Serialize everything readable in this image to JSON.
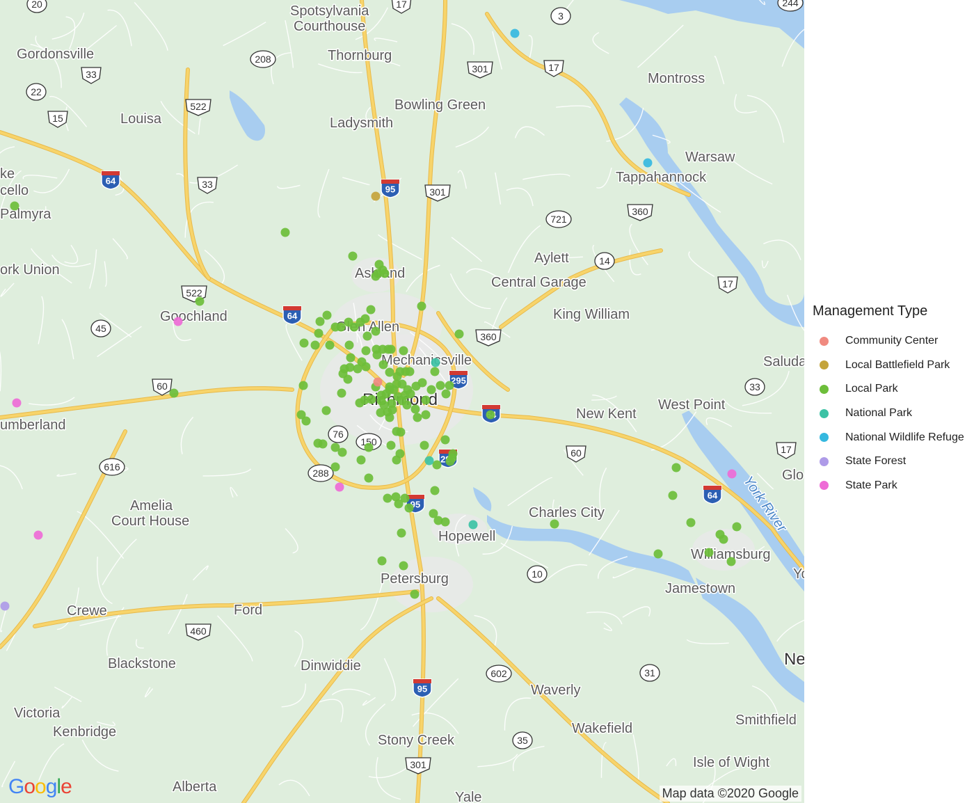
{
  "map": {
    "attribution": "Map data ©2020 Google",
    "logo": "Google",
    "logo_colors": [
      "#4285F4",
      "#EA4335",
      "#FBBC05",
      "#4285F4",
      "#34A853",
      "#EA4335"
    ],
    "colors": {
      "land": "#dfeedd",
      "water": "#a8cdf0",
      "highway": "#f7d46b",
      "urban": "#e9e9e9"
    },
    "places": [
      {
        "name": "Spotsylvania",
        "kind": "city"
      },
      {
        "name": "Courthouse",
        "kind": "city"
      },
      {
        "name": "Gordonsville",
        "kind": "city"
      },
      {
        "name": "Thornburg",
        "kind": "city"
      },
      {
        "name": "Montross",
        "kind": "city"
      },
      {
        "name": "Bowling Green",
        "kind": "city"
      },
      {
        "name": "Louisa",
        "kind": "city"
      },
      {
        "name": "Ladysmith",
        "kind": "city"
      },
      {
        "name": "Warsaw",
        "kind": "city"
      },
      {
        "name": "Tappahannock",
        "kind": "city"
      },
      {
        "name": "ke",
        "kind": "city"
      },
      {
        "name": "cello",
        "kind": "city"
      },
      {
        "name": "Palmyra",
        "kind": "city"
      },
      {
        "name": "Aylett",
        "kind": "city"
      },
      {
        "name": "Ashland",
        "kind": "city"
      },
      {
        "name": "Central Garage",
        "kind": "city"
      },
      {
        "name": "ork Union",
        "kind": "city"
      },
      {
        "name": "King William",
        "kind": "city"
      },
      {
        "name": "Goochland",
        "kind": "city"
      },
      {
        "name": "Glen Allen",
        "kind": "city"
      },
      {
        "name": "Mechanicsville",
        "kind": "city"
      },
      {
        "name": "Saluda",
        "kind": "city"
      },
      {
        "name": "Richmond",
        "kind": "major"
      },
      {
        "name": "West Point",
        "kind": "city"
      },
      {
        "name": "New Kent",
        "kind": "city"
      },
      {
        "name": "umberland",
        "kind": "city"
      },
      {
        "name": "Glo",
        "kind": "city"
      },
      {
        "name": "York River",
        "kind": "water"
      },
      {
        "name": "Amelia",
        "kind": "city"
      },
      {
        "name": "Court House",
        "kind": "city"
      },
      {
        "name": "Charles City",
        "kind": "city"
      },
      {
        "name": "Hopewell",
        "kind": "city"
      },
      {
        "name": "Williamsburg",
        "kind": "city"
      },
      {
        "name": "Yo",
        "kind": "city"
      },
      {
        "name": "Petersburg",
        "kind": "city"
      },
      {
        "name": "Jamestown",
        "kind": "city"
      },
      {
        "name": "Crewe",
        "kind": "city"
      },
      {
        "name": "Ford",
        "kind": "city"
      },
      {
        "name": "Ne",
        "kind": "major"
      },
      {
        "name": "Blackstone",
        "kind": "city"
      },
      {
        "name": "Dinwiddie",
        "kind": "city"
      },
      {
        "name": "Waverly",
        "kind": "city"
      },
      {
        "name": "Victoria",
        "kind": "city"
      },
      {
        "name": "Kenbridge",
        "kind": "city"
      },
      {
        "name": "Smithfield",
        "kind": "city"
      },
      {
        "name": "Wakefield",
        "kind": "city"
      },
      {
        "name": "Stony Creek",
        "kind": "city"
      },
      {
        "name": "Isle of Wight",
        "kind": "city"
      },
      {
        "name": "Alberta",
        "kind": "city"
      },
      {
        "name": "Yale",
        "kind": "city"
      }
    ],
    "route_shields": [
      {
        "label": "20",
        "kind": "state"
      },
      {
        "label": "17",
        "kind": "us"
      },
      {
        "label": "244",
        "kind": "state"
      },
      {
        "label": "3",
        "kind": "state"
      },
      {
        "label": "208",
        "kind": "state"
      },
      {
        "label": "33",
        "kind": "us"
      },
      {
        "label": "301",
        "kind": "us"
      },
      {
        "label": "17",
        "kind": "us"
      },
      {
        "label": "22",
        "kind": "state"
      },
      {
        "label": "522",
        "kind": "us"
      },
      {
        "label": "15",
        "kind": "us"
      },
      {
        "label": "64",
        "kind": "interstate"
      },
      {
        "label": "33",
        "kind": "us"
      },
      {
        "label": "95",
        "kind": "interstate"
      },
      {
        "label": "301",
        "kind": "us"
      },
      {
        "label": "360",
        "kind": "us"
      },
      {
        "label": "721",
        "kind": "state"
      },
      {
        "label": "14",
        "kind": "state"
      },
      {
        "label": "522",
        "kind": "us"
      },
      {
        "label": "17",
        "kind": "us"
      },
      {
        "label": "64",
        "kind": "interstate"
      },
      {
        "label": "45",
        "kind": "state"
      },
      {
        "label": "360",
        "kind": "us"
      },
      {
        "label": "295",
        "kind": "interstate"
      },
      {
        "label": "60",
        "kind": "us"
      },
      {
        "label": "33",
        "kind": "state"
      },
      {
        "label": "64",
        "kind": "interstate"
      },
      {
        "label": "76",
        "kind": "state"
      },
      {
        "label": "150",
        "kind": "state"
      },
      {
        "label": "616",
        "kind": "state"
      },
      {
        "label": "60",
        "kind": "us"
      },
      {
        "label": "17",
        "kind": "us"
      },
      {
        "label": "295",
        "kind": "interstate"
      },
      {
        "label": "288",
        "kind": "state"
      },
      {
        "label": "64",
        "kind": "interstate"
      },
      {
        "label": "95",
        "kind": "interstate"
      },
      {
        "label": "10",
        "kind": "state"
      },
      {
        "label": "460",
        "kind": "us"
      },
      {
        "label": "95",
        "kind": "interstate"
      },
      {
        "label": "602",
        "kind": "state"
      },
      {
        "label": "31",
        "kind": "state"
      },
      {
        "label": "35",
        "kind": "state"
      },
      {
        "label": "301",
        "kind": "us"
      }
    ]
  },
  "legend": {
    "title": "Management Type",
    "items": [
      {
        "label": "Community Center",
        "color": "#F08A80"
      },
      {
        "label": "Local Battlefield Park",
        "color": "#C4A43B"
      },
      {
        "label": "Local Park",
        "color": "#6DBE3A"
      },
      {
        "label": "National Park",
        "color": "#3CC2A5"
      },
      {
        "label": "National Wildlife Refuge",
        "color": "#35B8DF"
      },
      {
        "label": "State Forest",
        "color": "#AE9BE8"
      },
      {
        "label": "State Park",
        "color": "#EE6BD6"
      }
    ]
  },
  "points": [
    {
      "type": "Local Park",
      "count": 142
    },
    {
      "type": "National Wildlife Refuge",
      "count": 2
    },
    {
      "type": "Local Battlefield Park",
      "count": 1
    },
    {
      "type": "Community Center",
      "count": 1
    },
    {
      "type": "National Park",
      "count": 3
    },
    {
      "type": "State Park",
      "count": 5
    },
    {
      "type": "State Forest",
      "count": 1
    }
  ]
}
